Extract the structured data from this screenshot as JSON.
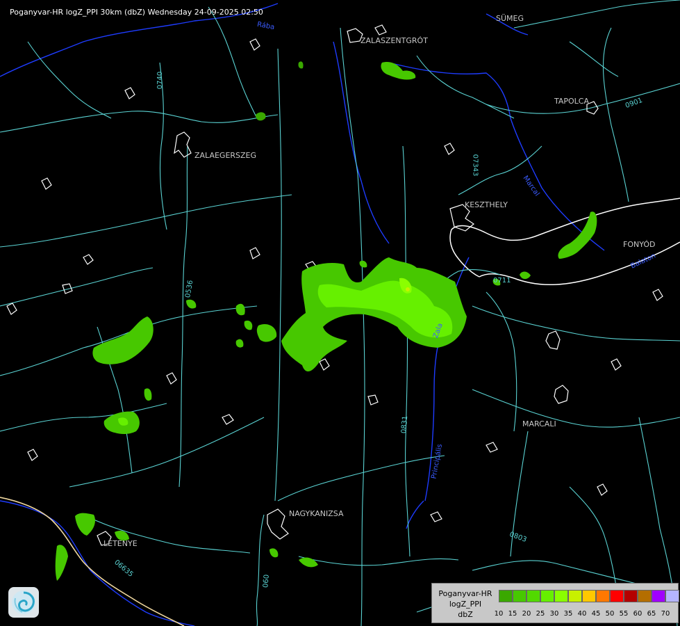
{
  "title": "Poganyvar-HR logZ_PPI 30km (dbZ) Wednesday 24-09-2025 02:50",
  "cities": {
    "sumeg": "SÜMEG",
    "zalaszentgrot": "ZALASZENTGRÓT",
    "tapolca": "TAPOLCA",
    "zalaegerszeg": "ZALAEGERSZEG",
    "keszthely": "KESZTHELY",
    "fonyod": "FONYÓD",
    "marcali": "MARCALI",
    "nagykanizsa": "NAGYKANIZSA",
    "letenye": "LETENYE"
  },
  "roads": {
    "r0740": "0740",
    "r07343": "07343",
    "r0536": "0536",
    "r0831": "0831",
    "r0803": "0803",
    "r06635": "06635",
    "r0901": "0901",
    "r060": "060",
    "r0711": "0711"
  },
  "rivers": {
    "zala": "Zala",
    "balaton": "Balaton",
    "principalis": "Principális",
    "raba": "Rába",
    "marcal": "Marcal"
  },
  "legend": {
    "line1": "Poganyvar-HR",
    "line2": "logZ_PPI",
    "line3": "dbZ",
    "bins": [
      {
        "value": "10",
        "color": "#3aa800"
      },
      {
        "value": "15",
        "color": "#47c800"
      },
      {
        "value": "20",
        "color": "#52d900"
      },
      {
        "value": "25",
        "color": "#66f000"
      },
      {
        "value": "30",
        "color": "#8aff00"
      },
      {
        "value": "35",
        "color": "#c8f000"
      },
      {
        "value": "40",
        "color": "#ffc800"
      },
      {
        "value": "45",
        "color": "#ff7800"
      },
      {
        "value": "50",
        "color": "#ff0000"
      },
      {
        "value": "55",
        "color": "#b40000"
      },
      {
        "value": "60",
        "color": "#b46e00"
      },
      {
        "value": "65",
        "color": "#a000ff"
      },
      {
        "value": "70",
        "color": "#b4b4ff"
      }
    ]
  },
  "colors": {
    "background": "#000000",
    "roads": "#5ad3d3",
    "rivers": "#1e3cff",
    "borders": "#ffffff",
    "country_border": "#f0d8a0"
  }
}
